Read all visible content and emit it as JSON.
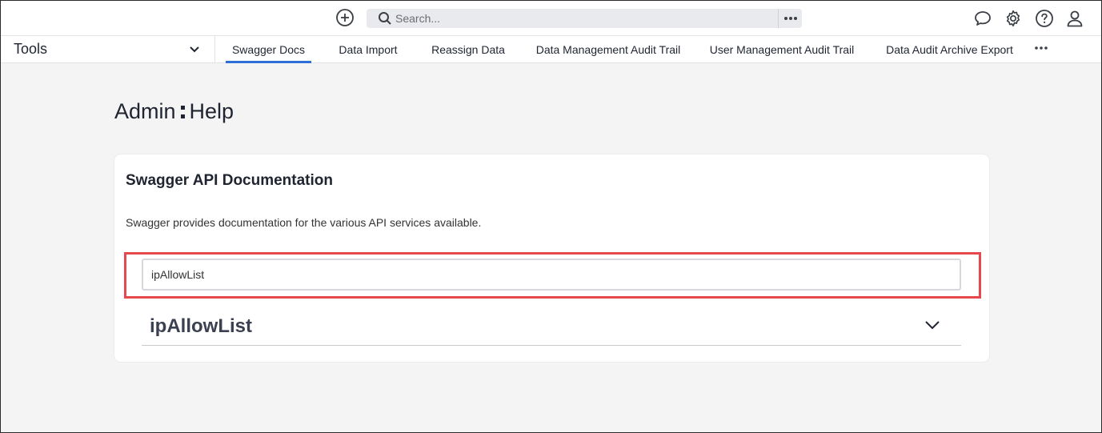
{
  "topbar": {
    "search_placeholder": "Search...",
    "icons": [
      "add-circle-icon",
      "search-icon",
      "more-horizontal-icon",
      "chat-bubble-icon",
      "gear-icon",
      "help-circle-icon",
      "user-icon"
    ]
  },
  "nav": {
    "tools_label": "Tools",
    "tabs": [
      {
        "label": "Swagger Docs",
        "active": true
      },
      {
        "label": "Data Import",
        "active": false
      },
      {
        "label": "Reassign Data",
        "active": false
      },
      {
        "label": "Data Management Audit Trail",
        "active": false
      },
      {
        "label": "User Management Audit Trail",
        "active": false
      },
      {
        "label": "Data Audit Archive Export",
        "active": false
      }
    ]
  },
  "page": {
    "title_left": "Admin",
    "title_right": "Help"
  },
  "card": {
    "title": "Swagger API Documentation",
    "description": "Swagger provides documentation for the various API services available.",
    "filter_value": "ipAllowList",
    "section_name": "ipAllowList"
  },
  "colors": {
    "accent": "#2c6fd6",
    "highlight": "#e5484d",
    "background": "#f4f4f5"
  }
}
